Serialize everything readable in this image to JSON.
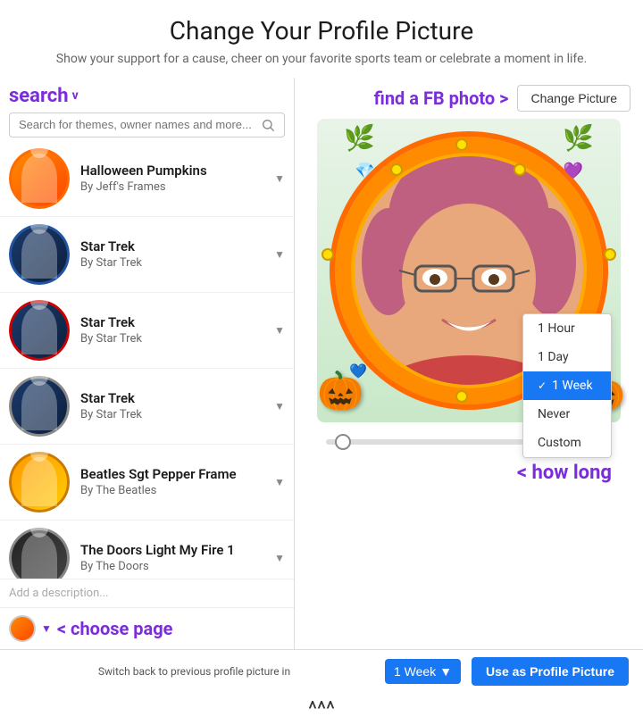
{
  "header": {
    "title": "Change Your Profile Picture",
    "subtitle": "Show your support for a cause, cheer on your favorite sports team or celebrate a moment in life."
  },
  "left": {
    "search_label": "search",
    "search_chevron": "v",
    "search_placeholder": "Search for themes, owner names and more...",
    "frames": [
      {
        "id": 1,
        "name": "Halloween Pumpkins",
        "author": "By Jeff's Frames",
        "thumb_class": "thumb-halloween"
      },
      {
        "id": 2,
        "name": "Star Trek",
        "author": "By Star Trek",
        "thumb_class": "thumb-startrek1"
      },
      {
        "id": 3,
        "name": "Star Trek",
        "author": "By Star Trek",
        "thumb_class": "thumb-startrek2"
      },
      {
        "id": 4,
        "name": "Star Trek",
        "author": "By Star Trek",
        "thumb_class": "thumb-startrek3"
      },
      {
        "id": 5,
        "name": "Beatles Sgt Pepper Frame",
        "author": "By The Beatles",
        "thumb_class": "thumb-beatles"
      },
      {
        "id": 6,
        "name": "The Doors Light My Fire 1",
        "author": "By The Doors",
        "thumb_class": "thumb-doors"
      }
    ],
    "description_placeholder": "Add a description...",
    "choose_page_label": "< choose page"
  },
  "right": {
    "find_fb_label": "find a FB photo >",
    "change_picture_btn": "Change Picture",
    "duration_options": [
      {
        "label": "1 Hour",
        "selected": false
      },
      {
        "label": "1 Day",
        "selected": false
      },
      {
        "label": "1 Week",
        "selected": true
      },
      {
        "label": "Never",
        "selected": false
      },
      {
        "label": "Custom",
        "selected": false
      }
    ],
    "how_long_label": "< how long"
  },
  "bottom": {
    "switch_back_text": "Switch back to previous profile picture in",
    "week_select_label": "1 Week",
    "use_profile_btn": "Use as Profile Picture",
    "arrows": "^^^"
  }
}
